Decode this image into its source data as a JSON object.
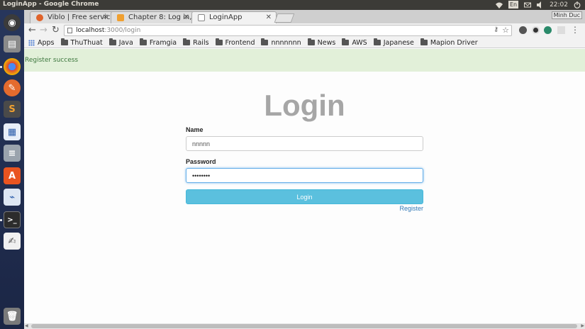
{
  "system": {
    "window_title": "LoginApp - Google Chrome",
    "lang": "En",
    "time": "22:02"
  },
  "browser": {
    "tabs": [
      {
        "label": "Viblo | Free service",
        "active": false
      },
      {
        "label": "Chapter 8: Log in, lo",
        "active": false
      },
      {
        "label": "LoginApp",
        "active": true
      }
    ],
    "profile_label": "Minh Duc",
    "url_host": "localhost",
    "url_path": ":3000/login",
    "bookmarks": [
      {
        "label": "Apps",
        "icon": "apps-icon"
      },
      {
        "label": "ThuThuat",
        "icon": "folder-icon"
      },
      {
        "label": "Java",
        "icon": "folder-icon"
      },
      {
        "label": "Framgia",
        "icon": "folder-icon"
      },
      {
        "label": "Rails",
        "icon": "folder-icon"
      },
      {
        "label": "Frontend",
        "icon": "folder-icon"
      },
      {
        "label": "nnnnnnn",
        "icon": "folder-icon"
      },
      {
        "label": "News",
        "icon": "folder-icon"
      },
      {
        "label": "AWS",
        "icon": "folder-icon"
      },
      {
        "label": "Japanese",
        "icon": "folder-icon"
      },
      {
        "label": "Mapion Driver",
        "icon": "folder-icon"
      }
    ]
  },
  "page": {
    "alert": "Register success",
    "heading": "Login",
    "name_label": "Name",
    "name_value": "nnnnn",
    "password_label": "Password",
    "password_value": "••••••••",
    "submit_label": "Login",
    "register_link": "Register"
  },
  "colors": {
    "alert_bg": "#e2f0d9",
    "button_bg": "#5bc0de",
    "link": "#337ab7"
  }
}
